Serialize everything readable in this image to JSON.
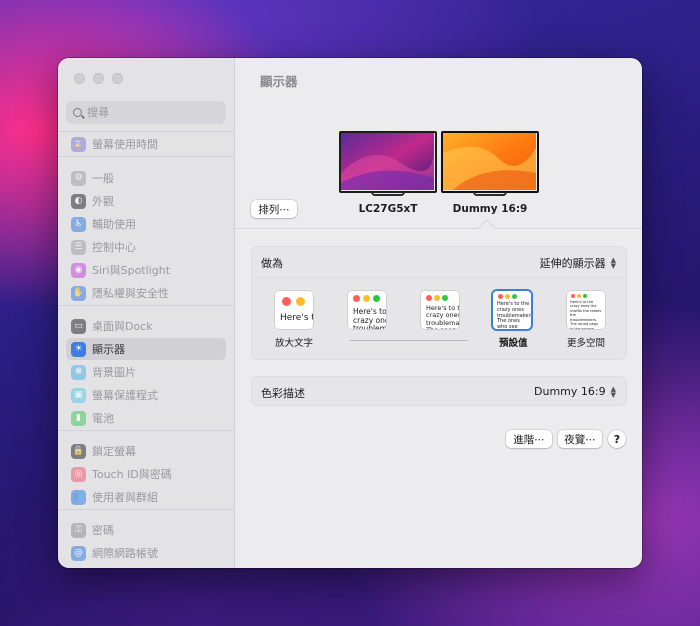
{
  "window": {
    "title": "顯示器"
  },
  "sidebar": {
    "search_placeholder": "搜尋",
    "items": [
      {
        "label": "螢幕使用時間",
        "icon": "hourglass-icon",
        "color": "#8e7bd4"
      },
      {
        "label": "一般",
        "icon": "gear-icon",
        "color": "#a0a0a4"
      },
      {
        "label": "外觀",
        "icon": "appearance-icon",
        "color": "#2c2c2e"
      },
      {
        "label": "輔助使用",
        "icon": "accessibility-icon",
        "color": "#3a7fe0"
      },
      {
        "label": "控制中心",
        "icon": "control-center-icon",
        "color": "#a0a0a4"
      },
      {
        "label": "Siri與Spotlight",
        "icon": "siri-icon",
        "color": "#c04bd8"
      },
      {
        "label": "隱私權與安全性",
        "icon": "hand-icon",
        "color": "#3a7fe0"
      },
      {
        "label": "桌面與Dock",
        "icon": "dock-icon",
        "color": "#2c2c2e"
      },
      {
        "label": "顯示器",
        "icon": "sun-icon",
        "color": "#3a7fe0"
      },
      {
        "label": "背景圖片",
        "icon": "wallpaper-icon",
        "color": "#4fb3e8"
      },
      {
        "label": "螢幕保護程式",
        "icon": "screensaver-icon",
        "color": "#5ac8e8"
      },
      {
        "label": "電池",
        "icon": "battery-icon",
        "color": "#48c760"
      },
      {
        "label": "鎖定螢幕",
        "icon": "lock-icon",
        "color": "#2c2c2e"
      },
      {
        "label": "Touch ID與密碼",
        "icon": "fingerprint-icon",
        "color": "#f06070"
      },
      {
        "label": "使用者與群組",
        "icon": "users-icon",
        "color": "#3a7fe0"
      },
      {
        "label": "密碼",
        "icon": "key-icon",
        "color": "#8e8e92"
      },
      {
        "label": "網際網路帳號",
        "icon": "at-icon",
        "color": "#3a7fe0"
      }
    ]
  },
  "displays": {
    "arrange_label": "排列⋯",
    "monitors": [
      {
        "name": "LC27G5xT"
      },
      {
        "name": "Dummy 16:9"
      }
    ]
  },
  "use_as": {
    "label": "做為",
    "value": "延伸的顯示器"
  },
  "resolution": {
    "sample_text": "Here's to the crazy ones",
    "sample_text_2": "Here's to the crazy ones troublemakers. The ones who see things differently. They're not fond of rules. And they",
    "sample_text_5": "Here's to the crazy ones the misfits the rebels the troublemakers. The round pegs in the square holes. The ones who see things differently. They're not fond of rules. And they have no respect for the status quo. You can quote them, disagree with them, glorify or vilify them. About the only thing you can't do is ignore them. Because they change things.",
    "labels": [
      "放大文字",
      "預設值",
      "更多空間"
    ]
  },
  "color_profile": {
    "label": "色彩描述",
    "value": "Dummy 16:9"
  },
  "buttons": {
    "advanced": "進階⋯",
    "night_shift": "夜覽⋯",
    "help": "?"
  },
  "colors": {
    "accent": "#3b82d6",
    "close": "#ff5f57",
    "minimize": "#febc2e",
    "zoom": "#28c840"
  }
}
